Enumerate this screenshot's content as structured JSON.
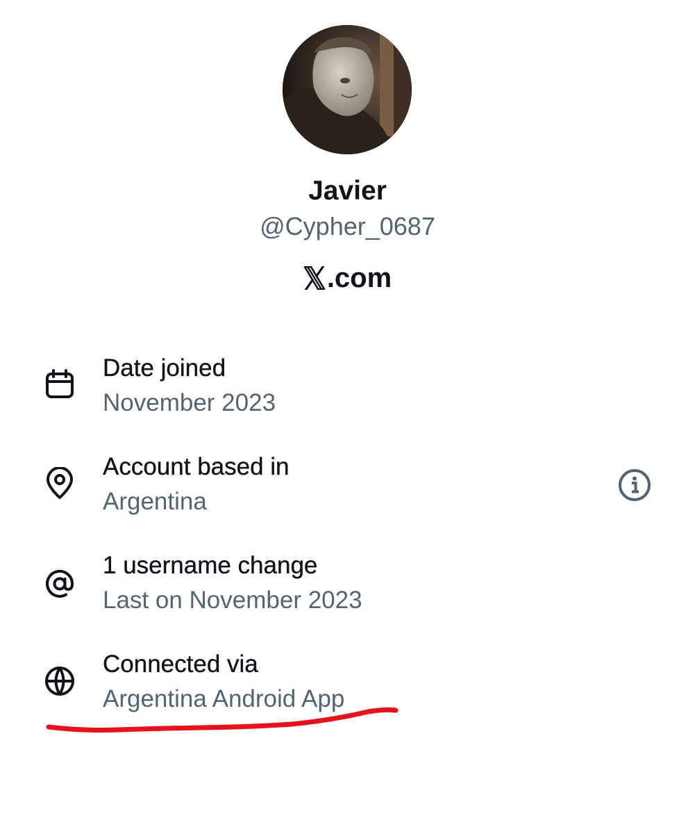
{
  "profile": {
    "display_name": "Javier",
    "handle": "@Cypher_0687",
    "site": ".com"
  },
  "details": [
    {
      "icon": "calendar-icon",
      "title": "Date joined",
      "value": "November 2023"
    },
    {
      "icon": "location-pin-icon",
      "title": "Account based in",
      "value": "Argentina"
    },
    {
      "icon": "at-sign-icon",
      "title": "1 username change",
      "value": "Last on November 2023"
    },
    {
      "icon": "globe-icon",
      "title": "Connected via",
      "value": "Argentina Android App"
    }
  ],
  "colors": {
    "primary_text": "#0f1419",
    "secondary_text": "#536471",
    "annotation": "#e8121b"
  }
}
